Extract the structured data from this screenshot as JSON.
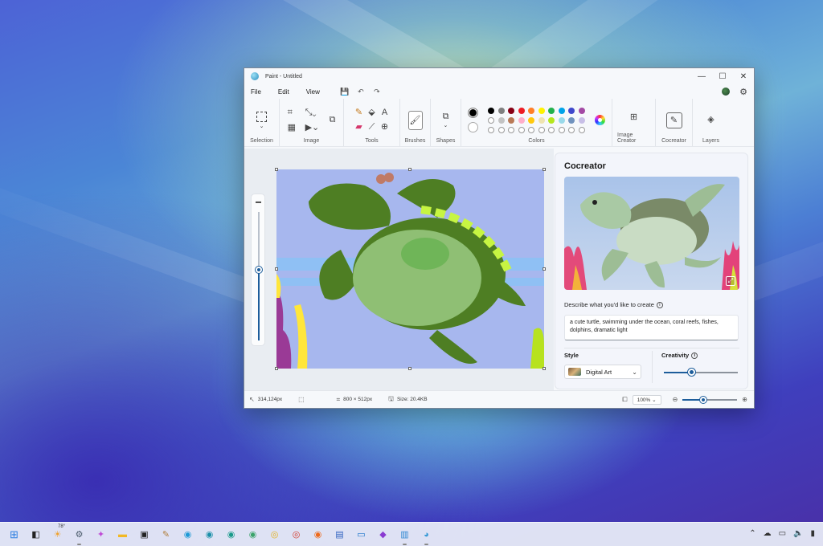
{
  "window": {
    "title": "Paint - Untitled",
    "controls": {
      "minimize": "—",
      "maximize": "☐",
      "close": "✕"
    }
  },
  "menu": {
    "items": [
      "File",
      "Edit",
      "View"
    ],
    "quick_actions": {
      "save": "💾",
      "undo": "↶",
      "redo": "↷"
    }
  },
  "ribbon": {
    "groups": {
      "selection": "Selection",
      "image": "Image",
      "tools": "Tools",
      "brushes": "Brushes",
      "shapes": "Shapes",
      "colors": "Colors",
      "image_creator": "Image Creator",
      "cocreator": "Cocreator",
      "layers": "Layers"
    },
    "primary_color": "#000000",
    "secondary_color": "#ffffff",
    "palette": [
      "#000000",
      "#7f7f7f",
      "#880015",
      "#ed1c24",
      "#ff7f27",
      "#fff200",
      "#22b14c",
      "#00a2e8",
      "#3f48cc",
      "#a349a4",
      "empty",
      "#c3c3c3",
      "#b97a57",
      "#ffaec9",
      "#ffc90e",
      "#efe4b0",
      "#b5e61d",
      "#99d9ea",
      "#7092be",
      "#c8bfe7",
      "empty",
      "empty",
      "empty",
      "empty",
      "empty",
      "empty",
      "empty",
      "empty",
      "empty",
      "empty"
    ]
  },
  "cocreator": {
    "title": "Cocreator",
    "describe_label": "Describe what you'd like to create",
    "prompt": "a cute turtle, swimming under the ocean, coral reefs, fishes, dolphins, dramatic light",
    "style_label": "Style",
    "style_value": "Digital Art",
    "creativity_label": "Creativity",
    "creativity_level": 0.37
  },
  "statusbar": {
    "cursor": "314,124px",
    "canvas_size": "800 × 512px",
    "file_size": "Size: 20.4KB",
    "zoom": "100%",
    "zoom_level": 0.38
  },
  "canvas_zoom_level": 0.55,
  "taskbar": {
    "weather": "78°",
    "icons": [
      "windows-start",
      "task-view",
      "weather-widget",
      "settings",
      "copilot",
      "file-explorer",
      "terminal",
      "paint-brush",
      "edge",
      "edge-beta",
      "edge-dev",
      "edge-canary",
      "chrome-canary",
      "chrome",
      "firefox",
      "word-doc",
      "remote-desktop",
      "store",
      "notepad",
      "paint"
    ]
  }
}
